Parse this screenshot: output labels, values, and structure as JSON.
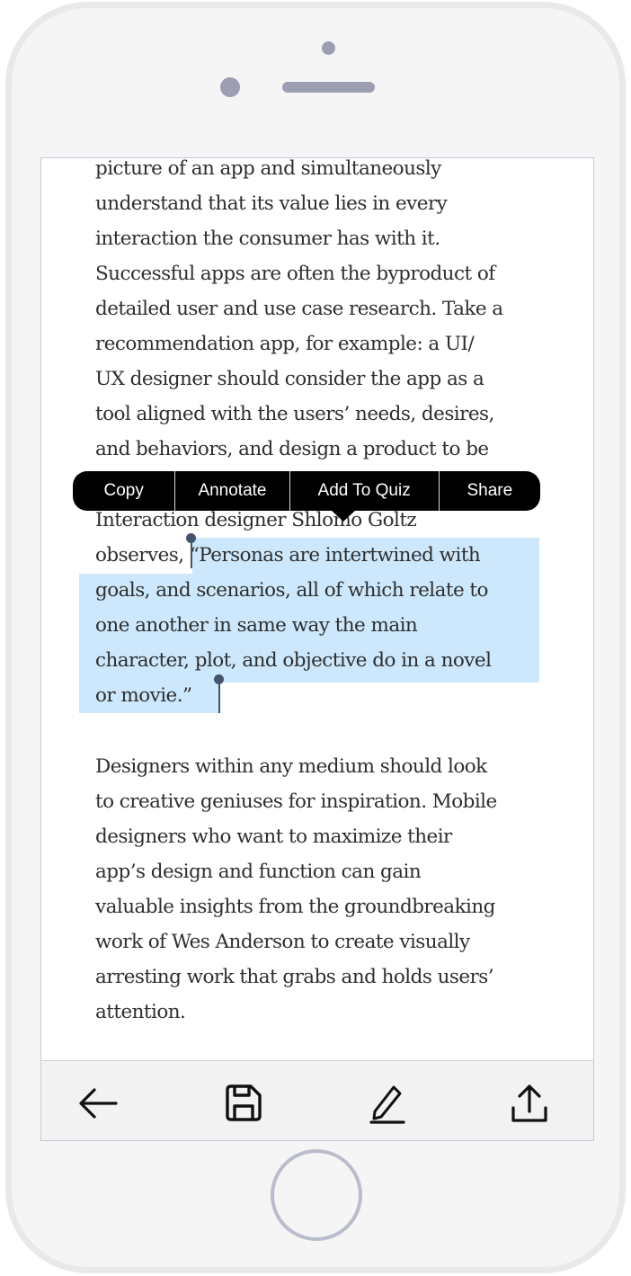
{
  "article": {
    "lines_before": [
      "picture of an app and simultaneously",
      "understand that its value lies in every",
      "interaction the consumer has with it.",
      "Successful apps are often the byproduct of",
      "detailed user and use case research. Take a",
      "recommendation app, for example: a UI/",
      "UX designer should consider the app as a",
      "tool aligned with the users’ needs, desires,",
      "and behaviors, and design a product to be"
    ],
    "line_hidden": "Interaction designer Shlomo Goltz",
    "sel_prefix": "observes, ",
    "sel_first": "“Personas are intertwined with",
    "sel_lines": [
      "goals, and scenarios, all of which relate to",
      "one another in same way the main",
      "character, plot, and objective do in a novel",
      "or movie.”"
    ],
    "paragraph2": [
      "Designers within any medium should look",
      "to creative geniuses for inspiration. Mobile",
      "designers who want to maximize their",
      "app’s design and function can gain",
      "valuable insights from the groundbreaking",
      "work of Wes Anderson to create visually",
      "arresting work that grabs and holds users’",
      "attention."
    ]
  },
  "context_menu": {
    "copy": "Copy",
    "annotate": "Annotate",
    "add_to_quiz": "Add To Quiz",
    "share": "Share"
  },
  "toolbar": {
    "icons": [
      "arrow-left-icon",
      "save-icon",
      "pencil-icon",
      "share-upload-icon"
    ]
  },
  "colors": {
    "selection": "#cde8fc",
    "menu_bg": "#000000",
    "cursor": "#44546d",
    "text": "#2e2e2e"
  }
}
